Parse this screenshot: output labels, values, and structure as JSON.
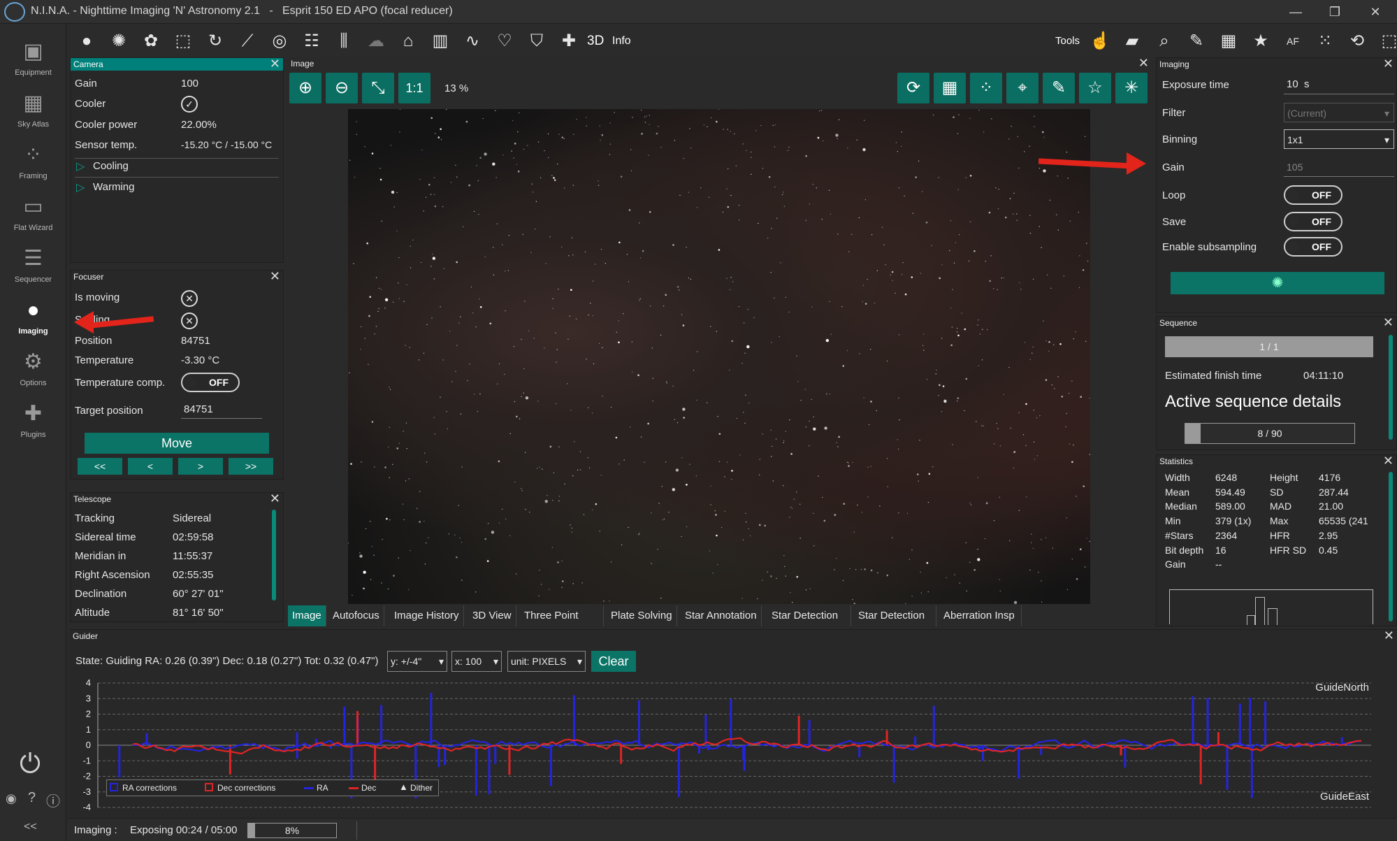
{
  "window": {
    "title": "N.I.N.A. - Nighttime Imaging 'N' Astronomy 2.1   -   Esprit 150 ED APO (focal reducer)"
  },
  "nav": [
    {
      "label": "Equipment",
      "icon": "camera-icon"
    },
    {
      "label": "Sky Atlas",
      "icon": "map-icon"
    },
    {
      "label": "Framing",
      "icon": "framing-icon"
    },
    {
      "label": "Flat Wizard",
      "icon": "flat-wizard-icon"
    },
    {
      "label": "Sequencer",
      "icon": "list-icon"
    },
    {
      "label": "Imaging",
      "icon": "imaging-icon"
    },
    {
      "label": "Options",
      "icon": "gear-icon"
    },
    {
      "label": "Plugins",
      "icon": "puzzle-icon"
    }
  ],
  "toolbar": {
    "text_3d": "3D",
    "text_info": "Info",
    "tools_label": "Tools"
  },
  "camera": {
    "title": "Camera",
    "rows": [
      {
        "label": "Gain",
        "value": "100"
      },
      {
        "label": "Cooler",
        "value": ""
      },
      {
        "label": "Cooler power",
        "value": "22.00%"
      },
      {
        "label": "Sensor temp.",
        "value": "-15.20 °C / -15.00 °C"
      }
    ],
    "expanders": [
      "Cooling",
      "Warming"
    ]
  },
  "focuser": {
    "title": "Focuser",
    "is_moving": "Is moving",
    "settling": "Settling",
    "position_label": "Position",
    "position_value": "84751",
    "temp_label": "Temperature",
    "temp_value": "-3.30 °C",
    "tempcomp_label": "Temperature comp.",
    "tempcomp_state": "OFF",
    "target_label": "Target position",
    "target_value": "84751",
    "move_label": "Move",
    "steps": [
      "<<",
      "<",
      ">",
      ">>"
    ]
  },
  "telescope": {
    "title": "Telescope",
    "rows": [
      {
        "label": "Tracking",
        "value": "Sidereal"
      },
      {
        "label": "Sidereal time",
        "value": "02:59:58"
      },
      {
        "label": "Meridian in",
        "value": "11:55:37"
      },
      {
        "label": "Right Ascension",
        "value": "02:55:35"
      },
      {
        "label": "Declination",
        "value": "60° 27' 01\""
      },
      {
        "label": "Altitude",
        "value": "81° 16' 50\""
      }
    ]
  },
  "image": {
    "title": "Image",
    "one_to_one": "1:1",
    "zoom": "13 %",
    "tabs": [
      "Image",
      "Autofocus",
      "Image History",
      "3D View",
      "Three Point Pola",
      "Plate Solving",
      "Star Annotation",
      "Star Detection F",
      "Star Detection C",
      "Aberration Insp"
    ]
  },
  "imaging": {
    "title": "Imaging",
    "exposure_label": "Exposure time",
    "exposure_value": "10",
    "exposure_unit": "s",
    "filter_label": "Filter",
    "filter_value": "(Current)",
    "binning_label": "Binning",
    "binning_value": "1x1",
    "gain_label": "Gain",
    "gain_value": "105",
    "loop_label": "Loop",
    "loop_state": "OFF",
    "save_label": "Save",
    "save_state": "OFF",
    "subsample_label": "Enable subsampling",
    "subsample_state": "OFF"
  },
  "sequence": {
    "title": "Sequence",
    "progress": "1 / 1",
    "progress_fraction": 1.0,
    "finish_label": "Estimated finish time",
    "finish_value": "04:11:10",
    "details_label": "Active sequence details",
    "sub_progress": "8 / 90",
    "sub_fraction": 0.089
  },
  "statistics": {
    "title": "Statistics",
    "left": [
      {
        "label": "Width",
        "value": "6248"
      },
      {
        "label": "Mean",
        "value": "594.49"
      },
      {
        "label": "Median",
        "value": "589.00"
      },
      {
        "label": "Min",
        "value": "379 (1x)"
      },
      {
        "label": "#Stars",
        "value": "2364"
      },
      {
        "label": "Bit depth",
        "value": "16"
      },
      {
        "label": "Gain",
        "value": "--"
      }
    ],
    "right": [
      {
        "label": "Height",
        "value": "4176"
      },
      {
        "label": "SD",
        "value": "287.44"
      },
      {
        "label": "MAD",
        "value": "21.00"
      },
      {
        "label": "Max",
        "value": "65535 (241"
      },
      {
        "label": "HFR",
        "value": "2.95"
      },
      {
        "label": "HFR SD",
        "value": "0.45"
      }
    ]
  },
  "guider": {
    "title": "Guider",
    "state": "State: Guiding  RA: 0.26 (0.39\")  Dec: 0.18 (0.27\")  Tot: 0.32 (0.47\")",
    "y_select": "y: +/-4\"",
    "x_select": "x: 100",
    "unit_select": "unit: PIXELS",
    "clear_label": "Clear",
    "north_label": "GuideNorth",
    "east_label": "GuideEast",
    "legend": [
      "RA corrections",
      "Dec corrections",
      "RA",
      "Dec",
      "Dither"
    ]
  },
  "chart_data": {
    "type": "line",
    "ylim": [
      -4,
      4
    ],
    "yticks": [
      "4",
      "3",
      "2",
      "1",
      "0",
      "-1",
      "-2",
      "-3",
      "-4"
    ],
    "series": [
      {
        "name": "RA",
        "color": "#2424e0"
      },
      {
        "name": "Dec",
        "color": "#e02424"
      },
      {
        "name": "RA corrections",
        "color": "#2424e0"
      },
      {
        "name": "Dec corrections",
        "color": "#e02424"
      }
    ]
  },
  "status": {
    "imaging_label": "Imaging :",
    "exposing": "Exposing 00:24 / 05:00",
    "progress_text": "8%",
    "progress_fraction": 0.08
  }
}
